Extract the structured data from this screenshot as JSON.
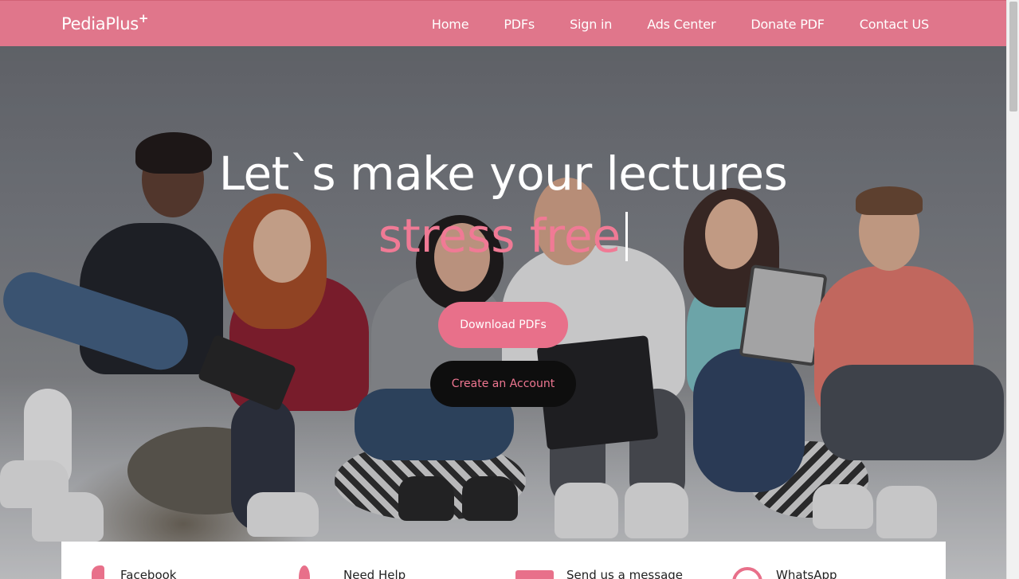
{
  "brand": {
    "name": "PediaPlus",
    "mark": "+"
  },
  "nav": {
    "items": [
      {
        "label": "Home"
      },
      {
        "label": "PDFs"
      },
      {
        "label": "Sign in"
      },
      {
        "label": "Ads Center"
      },
      {
        "label": "Donate PDF"
      },
      {
        "label": "Contact US"
      }
    ]
  },
  "hero": {
    "headline": "Let`s make your lectures",
    "highlight": "stress free",
    "primary_button": "Download PDFs",
    "secondary_button": "Create an Account"
  },
  "contact": {
    "items": [
      {
        "label": "Facebook",
        "icon": "facebook-icon"
      },
      {
        "label": "Need Help",
        "icon": "help-icon"
      },
      {
        "label": "Send us a message",
        "icon": "mail-icon"
      },
      {
        "label": "WhatsApp",
        "icon": "whatsapp-icon"
      }
    ]
  },
  "colors": {
    "navbar": "#e0768b",
    "accent": "#e8708a",
    "dark_button": "#0e0e0e"
  }
}
